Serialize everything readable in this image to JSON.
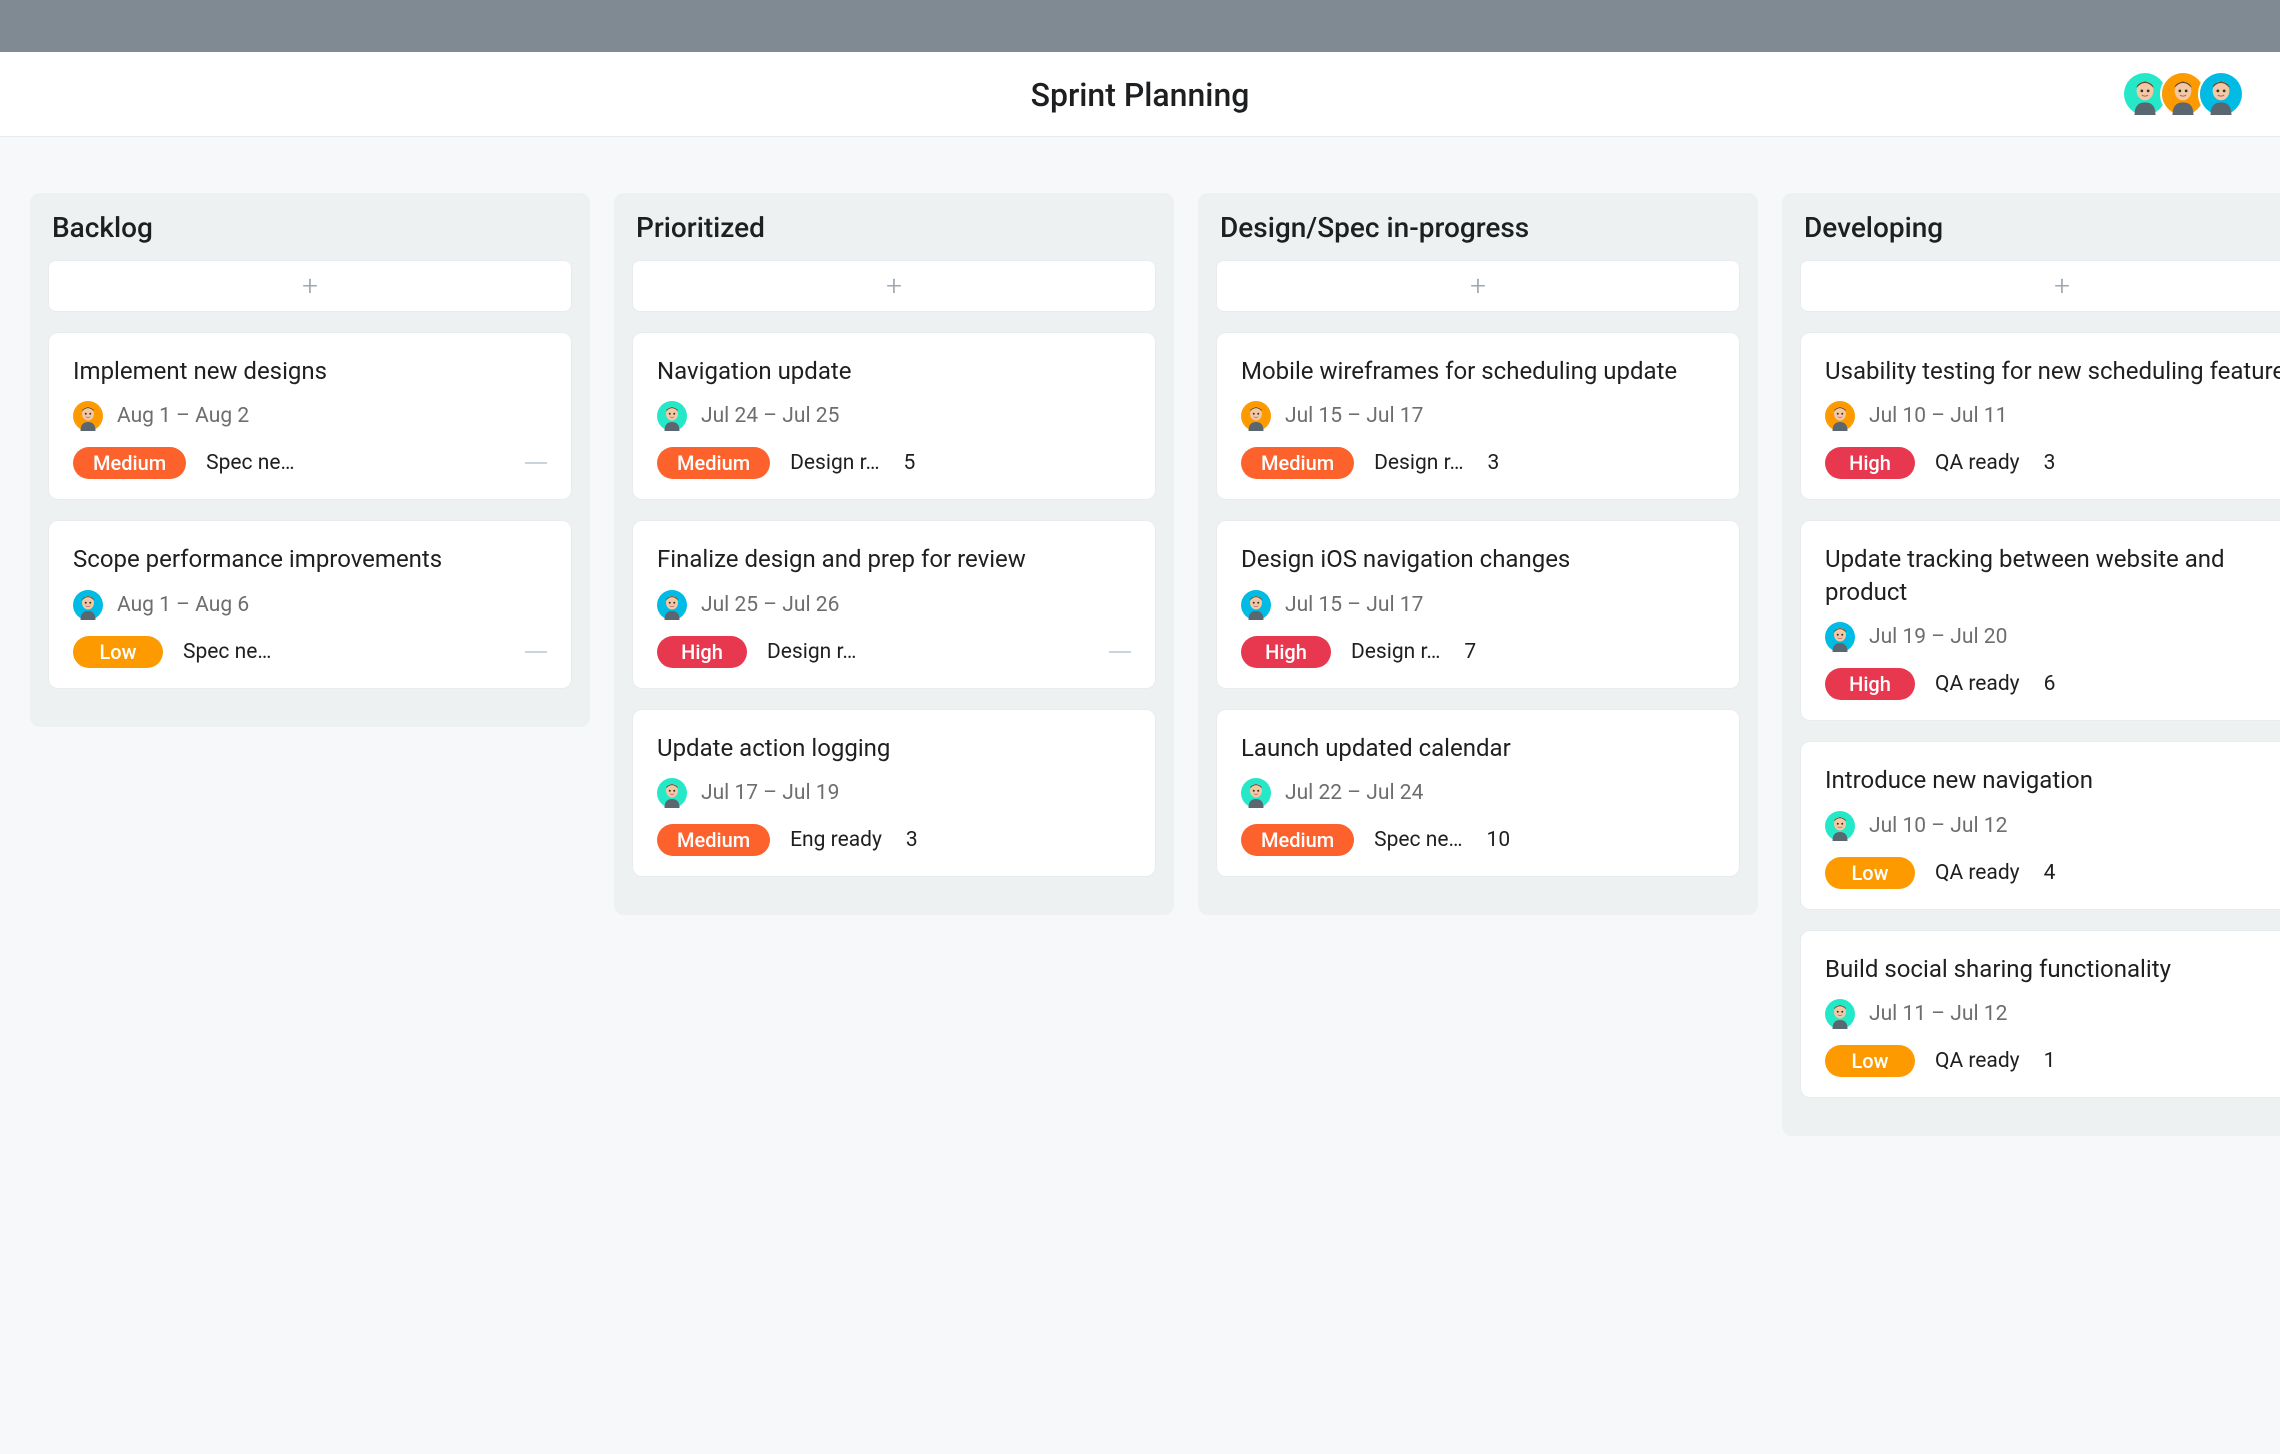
{
  "page": {
    "title": "Sprint Planning"
  },
  "header_avatars": [
    "teal",
    "yellow",
    "cyan"
  ],
  "priority_colors": {
    "High": "pill-pink",
    "Medium": "pill-orange",
    "Low": "pill-yellow"
  },
  "avatar_colors": {
    "teal": "#25e8c8",
    "yellow": "#fd9a00",
    "cyan": "#00bce4"
  },
  "columns": [
    {
      "title": "Backlog",
      "cards": [
        {
          "title": "Implement new designs",
          "avatar": "yellow",
          "date": "Aug 1 – Aug 2",
          "priority": "Medium",
          "status": "Spec ne…",
          "count": null,
          "dash": true
        },
        {
          "title": "Scope performance improvements",
          "avatar": "cyan",
          "date": "Aug 1 – Aug 6",
          "priority": "Low",
          "status": "Spec ne…",
          "count": null,
          "dash": true
        }
      ]
    },
    {
      "title": "Prioritized",
      "cards": [
        {
          "title": "Navigation update",
          "avatar": "teal",
          "date": "Jul 24 – Jul 25",
          "priority": "Medium",
          "status": "Design r…",
          "count": "5",
          "dash": false
        },
        {
          "title": "Finalize design and prep for review",
          "avatar": "cyan",
          "date": "Jul 25 – Jul 26",
          "priority": "High",
          "status": "Design r…",
          "count": null,
          "dash": true
        },
        {
          "title": "Update action logging",
          "avatar": "teal",
          "date": "Jul 17 – Jul 19",
          "priority": "Medium",
          "status": "Eng ready",
          "count": "3",
          "dash": false
        }
      ]
    },
    {
      "title": "Design/Spec in-progress",
      "cards": [
        {
          "title": "Mobile wireframes for scheduling update",
          "avatar": "yellow",
          "date": "Jul 15 – Jul 17",
          "priority": "Medium",
          "status": "Design r…",
          "count": "3",
          "dash": false
        },
        {
          "title": "Design iOS navigation changes",
          "avatar": "cyan",
          "date": "Jul 15 – Jul 17",
          "priority": "High",
          "status": "Design r…",
          "count": "7",
          "dash": false
        },
        {
          "title": "Launch updated calendar",
          "avatar": "teal",
          "date": "Jul 22 – Jul 24",
          "priority": "Medium",
          "status": "Spec ne…",
          "count": "10",
          "dash": false
        }
      ]
    },
    {
      "title": "Developing",
      "cards": [
        {
          "title": "Usability testing for new scheduling feature",
          "avatar": "yellow",
          "date": "Jul 10 – Jul 11",
          "priority": "High",
          "status": "QA ready",
          "count": "3",
          "dash": false
        },
        {
          "title": "Update tracking between website and product",
          "avatar": "cyan",
          "date": "Jul 19 – Jul 20",
          "priority": "High",
          "status": "QA ready",
          "count": "6",
          "dash": false
        },
        {
          "title": "Introduce new navigation",
          "avatar": "teal",
          "date": "Jul 10 – Jul 12",
          "priority": "Low",
          "status": "QA ready",
          "count": "4",
          "dash": false
        },
        {
          "title": "Build social sharing functionality",
          "avatar": "teal",
          "date": "Jul 11 – Jul 12",
          "priority": "Low",
          "status": "QA ready",
          "count": "1",
          "dash": false
        }
      ]
    }
  ]
}
